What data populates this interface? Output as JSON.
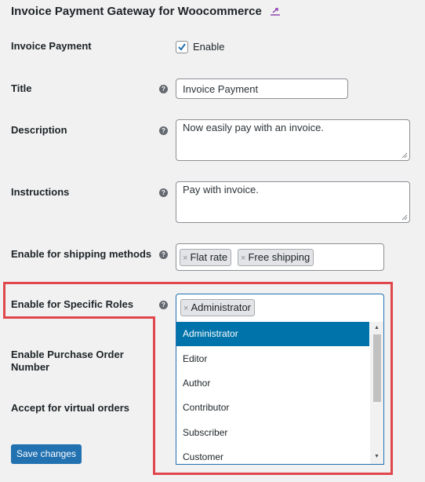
{
  "header": {
    "title": "Invoice Payment Gateway for Woocommerce",
    "link_icon": "external-link-icon"
  },
  "fields": {
    "enabled": {
      "label": "Invoice Payment",
      "checkbox_label": "Enable",
      "checked": true
    },
    "title": {
      "label": "Title",
      "value": "Invoice Payment"
    },
    "description": {
      "label": "Description",
      "value": "Now easily pay with an invoice."
    },
    "instructions": {
      "label": "Instructions",
      "value": "Pay with invoice."
    },
    "shipping_methods": {
      "label": "Enable for shipping methods",
      "selected": [
        "Flat rate",
        "Free shipping"
      ]
    },
    "specific_roles": {
      "label": "Enable for Specific Roles",
      "selected": [
        "Administrator"
      ],
      "options": [
        "Administrator",
        "Editor",
        "Author",
        "Contributor",
        "Subscriber",
        "Customer"
      ],
      "highlighted": "Administrator"
    },
    "purchase_order": {
      "label": "Enable Purchase Order Number"
    },
    "virtual_orders": {
      "label": "Accept for virtual orders"
    }
  },
  "actions": {
    "save_label": "Save changes"
  },
  "colors": {
    "accent": "#2271b1",
    "highlight": "#0073aa",
    "annotation": "#e0474c"
  }
}
